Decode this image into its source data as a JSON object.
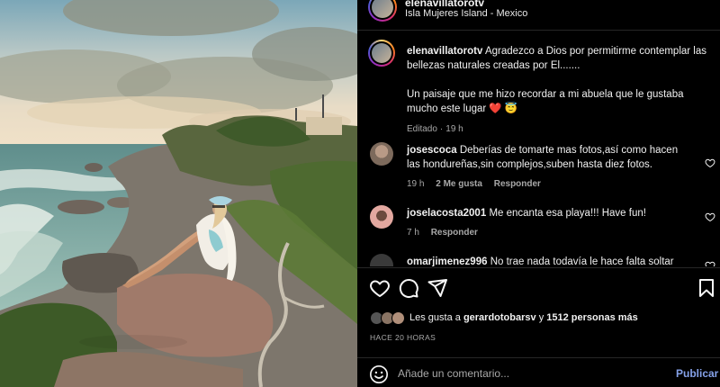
{
  "post": {
    "username": "elenavillatorotv",
    "location": "Isla Mujeres Island - Mexico"
  },
  "caption": {
    "username": "elenavillatorotv",
    "line1": "Agradezco a Dios por permitirme contemplar las bellezas naturales creadas por El.......",
    "line2": "Un paisaje que me hizo recordar a mi abuela que le gustaba mucho este lugar",
    "emojis": "❤️ 😇",
    "edited_label": "Editado",
    "age": "19 h"
  },
  "comments": [
    {
      "username": "josescoca",
      "text": "Deberías de tomarte mas fotos,así como hacen las hondureñas,sin complejos,suben hasta diez fotos.",
      "age": "19 h",
      "likes": "2 Me gusta",
      "reply_label": "Responder"
    },
    {
      "username": "joselacosta2001",
      "text": "Me encanta esa playa!!! Have fun!",
      "age": "7 h",
      "reply_label": "Responder"
    },
    {
      "username": "omarjimenez996",
      "text": "No trae nada todavía le hace falta soltar su"
    }
  ],
  "likes": {
    "prefix": "Les gusta a",
    "user": "gerardotobarsv",
    "connector": "y",
    "count_text": "1512 personas más"
  },
  "timestamp": "HACE 20 HORAS",
  "add_comment": {
    "placeholder": "Añade un comentario...",
    "post_label": "Publicar"
  },
  "icons": {
    "like": "heart-icon",
    "comment": "comment-bubble-icon",
    "share": "paper-plane-icon",
    "save": "bookmark-icon",
    "emoji": "smiley-icon"
  },
  "colors": {
    "background": "#000000",
    "link_blue": "#85a1e8",
    "secondary_text": "#a8a8a8",
    "divider": "#262626"
  }
}
